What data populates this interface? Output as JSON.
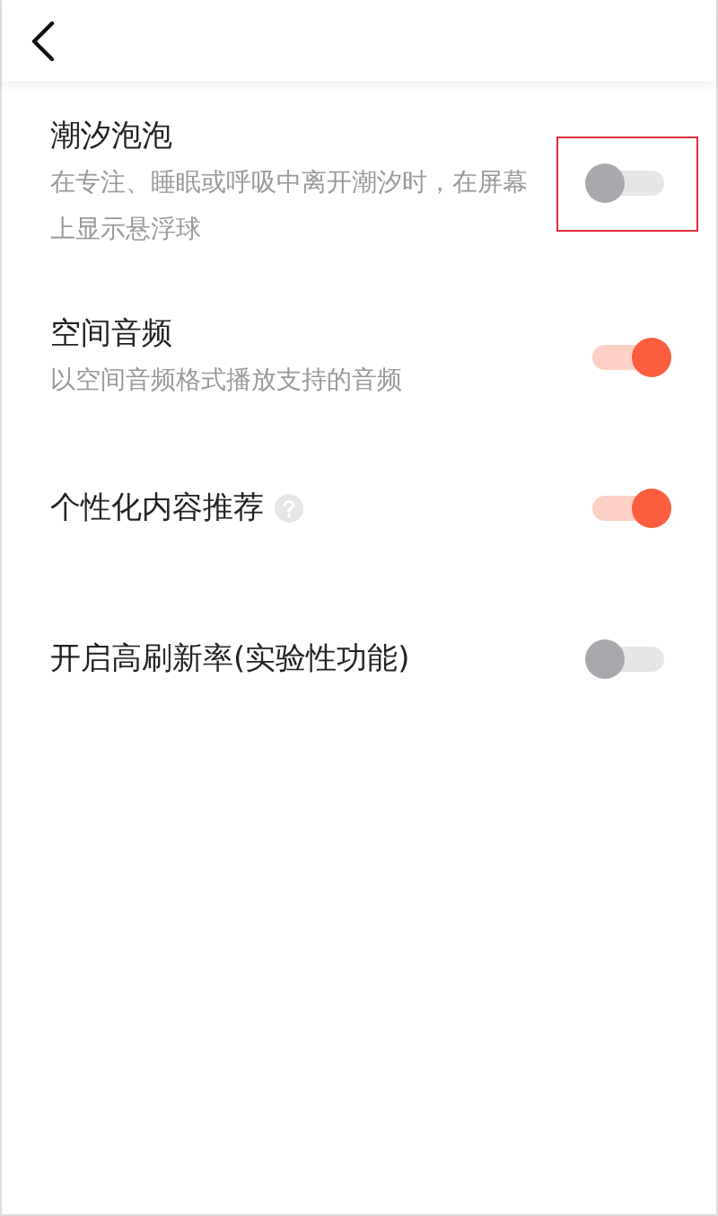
{
  "header": {
    "back": true
  },
  "settings": [
    {
      "title": "潮汐泡泡",
      "description": "在专注、睡眠或呼吸中离开潮汐时，在屏幕上显示悬浮球",
      "on": false,
      "highlighted": true,
      "help": false
    },
    {
      "title": "空间音频",
      "description": "以空间音频格式播放支持的音频",
      "on": true,
      "highlighted": false,
      "help": false
    },
    {
      "title": "个性化内容推荐",
      "on": true,
      "highlighted": false,
      "help": true
    },
    {
      "title": "开启高刷新率(实验性功能)",
      "on": false,
      "highlighted": false,
      "help": false
    }
  ]
}
